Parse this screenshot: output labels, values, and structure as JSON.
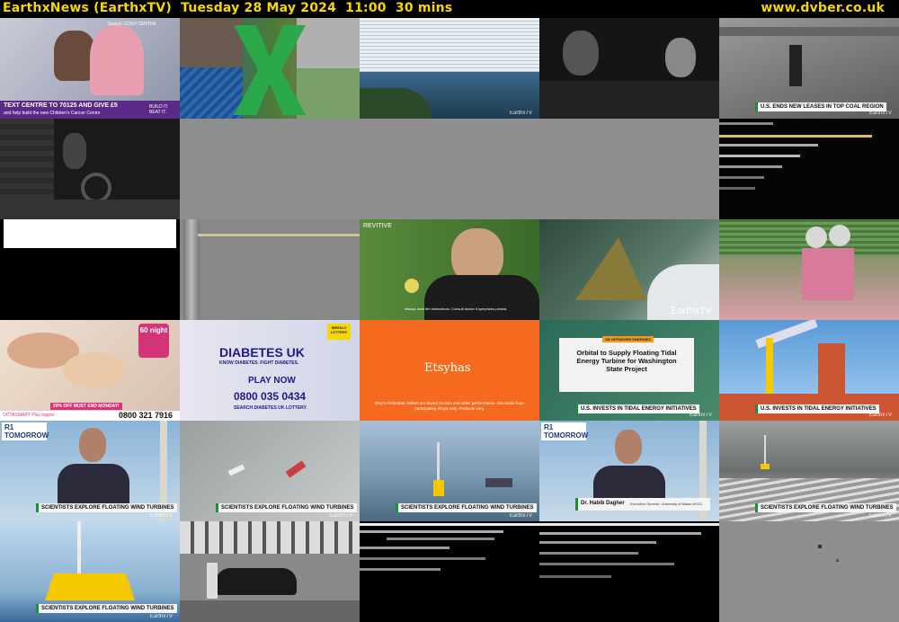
{
  "header": {
    "channel": "EarthxNews (EarthxTV)",
    "datetime": "Tuesday 28 May 2024  11:00  30 mins",
    "site": "www.dvber.co.uk"
  },
  "colors": {
    "header_text": "#f5d800",
    "background": "#000000"
  },
  "thumbnails": [
    {
      "text": "TEXT CENTRE TO 70125 AND GIVE £5",
      "sub": "and help build the new Children's Cancer Centre",
      "extra": "Search GOSH CENTRE",
      "logo": "BUILD IT. BEAT IT."
    },
    {
      "text": ""
    },
    {
      "text": "",
      "brand": "EarthxTV"
    },
    {
      "text": ""
    },
    {
      "text": "U.S. ENDS NEW LEASES IN TOP COAL REGION",
      "brand": "EarthxTV"
    },
    {
      "text": ""
    },
    {
      "text": ""
    },
    {
      "text": ""
    },
    {
      "text": ""
    },
    {
      "text": ""
    },
    {
      "text": ""
    },
    {
      "text": ""
    },
    {
      "text": "REVITIVE",
      "sub": "Always read the instructions. Consult doctor if symptoms persist."
    },
    {
      "text": "",
      "brand": "EarthxTV"
    },
    {
      "text": ""
    },
    {
      "text": "60 night",
      "sub": "20% OFF  MUST END MONDAY!",
      "extra": "0800 321 7916",
      "logo": "OCTASMART Plus topper"
    },
    {
      "text": "DIABETES UK",
      "sub": "KNOW DIABETES. FIGHT DIABETES.",
      "extra": "PLAY NOW",
      "phone": "0800 035 0434",
      "tag": "SEARCH DIABETES UK LOTTERY",
      "badge": "WEEKLY LOTTERY"
    },
    {
      "text": "Etsyhas",
      "sub": "Etsy's Picks/Star Sellers are based on item and seller performance. Discounts from participating shops only. Products vary."
    },
    {
      "text": "U.S. INVESTS IN TIDAL ENERGY INITIATIVES",
      "headline": "Orbital to Supply Floating Tidal Energy Turbine for Washington State Project",
      "badge": "OE OFFSHORE ENERGIES",
      "brand": "EarthxTV"
    },
    {
      "text": "U.S. INVESTS IN TIDAL ENERGY INITIATIVES",
      "brand": "EarthxTV"
    },
    {
      "text": "SCIENTISTS EXPLORE FLOATING WIND TURBINES",
      "badge": "R1 TOMORROW",
      "brand": "EarthxTV"
    },
    {
      "text": "SCIENTISTS EXPLORE FLOATING WIND TURBINES",
      "brand": "EarthxTV"
    },
    {
      "text": "SCIENTISTS EXPLORE FLOATING WIND TURBINES",
      "brand": "EarthxTV"
    },
    {
      "text": "Dr. Habib Dagher",
      "sub": "Executive Director, University of Maine ASCC",
      "badge": "R1 TOMORROW"
    },
    {
      "text": "SCIENTISTS EXPLORE FLOATING WIND TURBINES",
      "brand": "EarthxTV"
    },
    {
      "text": "SCIENTISTS EXPLORE FLOATING WIND TURBINES",
      "brand": "EarthxTV"
    },
    {
      "text": ""
    },
    {
      "text": ""
    },
    {
      "text": ""
    },
    {
      "text": ""
    }
  ]
}
